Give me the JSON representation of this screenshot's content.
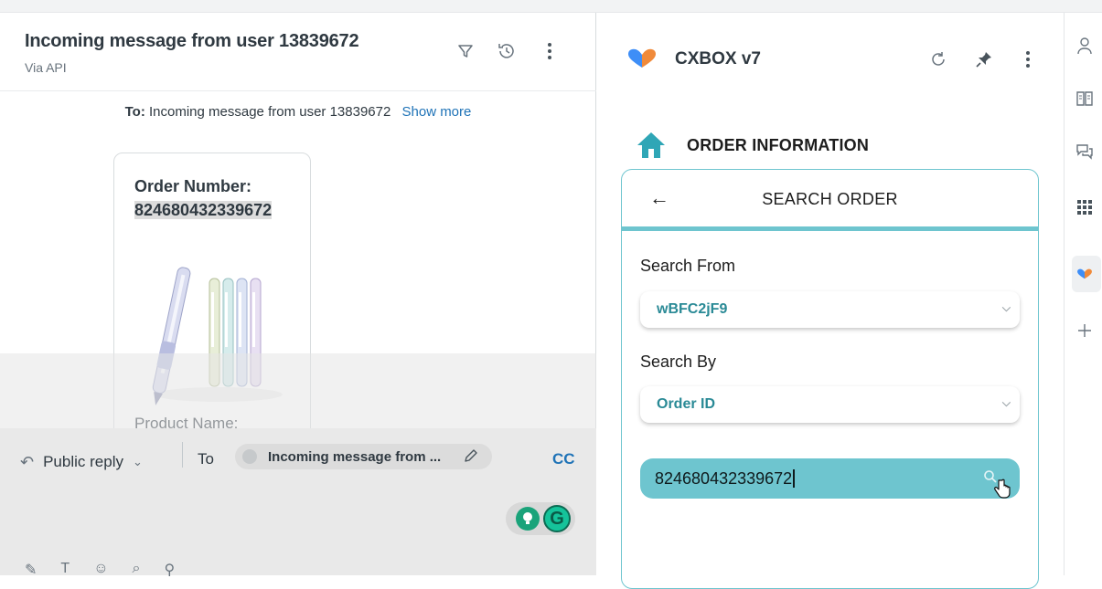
{
  "ticket": {
    "title": "Incoming message from user 13839672",
    "via": "Via API",
    "to_label": "To:",
    "to_value": "Incoming message from user 13839672",
    "show_more": "Show more"
  },
  "message_card": {
    "order_label": "Order Number:",
    "order_number": "824680432339672",
    "product_label": "Product Name:"
  },
  "reply": {
    "mode": "Public reply",
    "to_label": "To",
    "recipient": "Incoming message from ...",
    "cc": "CC"
  },
  "app": {
    "name": "CXBOX v7",
    "section_title": "ORDER INFORMATION",
    "panel_title": "SEARCH ORDER",
    "search_from_label": "Search From",
    "search_from_value": "wBFC2jF9",
    "search_by_label": "Search By",
    "search_by_value": "Order ID",
    "search_input_value": "824680432339672"
  },
  "colors": {
    "teal": "#6ec5cf",
    "teal_text": "#2a8a96",
    "link_blue": "#1f73b7",
    "grammarly_green": "#15c39a"
  },
  "icons": {
    "header_left": [
      "filter-icon",
      "history-icon",
      "more-vertical-icon"
    ],
    "header_app": [
      "refresh-icon",
      "pin-icon",
      "more-vertical-icon"
    ],
    "sidebar": [
      "user-icon",
      "book-icon",
      "chat-icon",
      "apps-grid-icon",
      "cxbox-app-icon",
      "plus-icon"
    ]
  }
}
